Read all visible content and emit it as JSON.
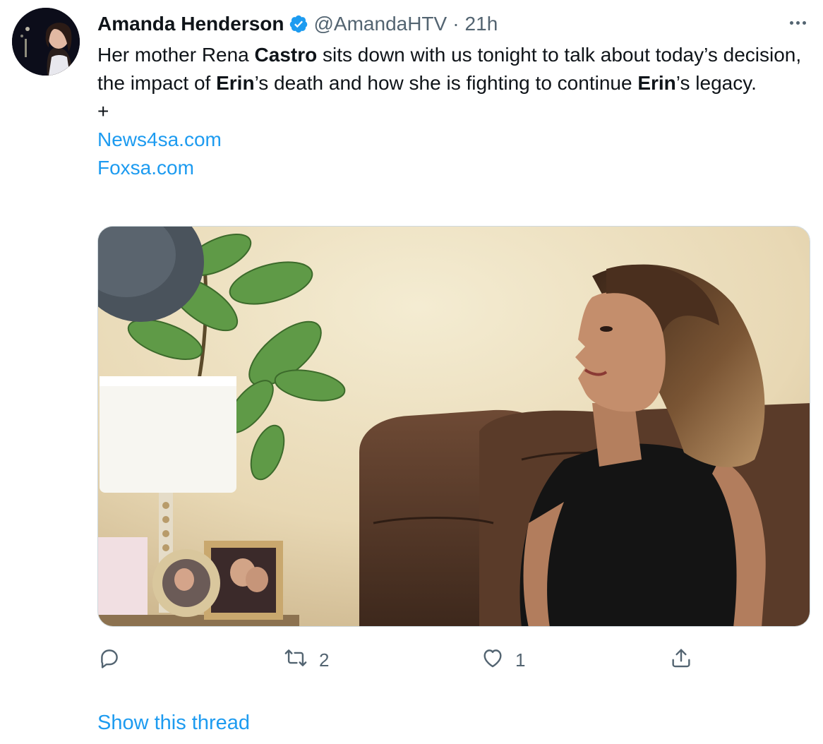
{
  "tweet": {
    "author": {
      "display_name": "Amanda Henderson",
      "handle": "@AmandaHTV",
      "verified": true,
      "verified_color": "#1d9bf0"
    },
    "separator": "·",
    "timestamp": "21h",
    "more_icon": "ellipsis-icon",
    "text": {
      "line1_a": "Her mother Rena ",
      "line1_bold": "Castro",
      "line1_b": " sits down with us tonight to talk about today’s decision, the impact of ",
      "line2_bold": "Erin",
      "line2_b": "’s death and how she is fighting to continue ",
      "line3_bold": "Erin",
      "line3_b": "’s legacy.",
      "plus": "+",
      "links": [
        "News4sa.com",
        "Foxsa.com"
      ]
    },
    "media": {
      "type": "photo",
      "description_icon": "interview-photo"
    },
    "actions": {
      "reply": {
        "icon": "reply-icon",
        "count": ""
      },
      "retweet": {
        "icon": "retweet-icon",
        "count": "2"
      },
      "like": {
        "icon": "heart-icon",
        "count": "1"
      },
      "share": {
        "icon": "share-icon",
        "count": ""
      }
    },
    "show_thread": "Show this thread"
  },
  "colors": {
    "text": "#0f1419",
    "secondary": "#536471",
    "link": "#1d9bf0",
    "border": "#cfd9de"
  }
}
